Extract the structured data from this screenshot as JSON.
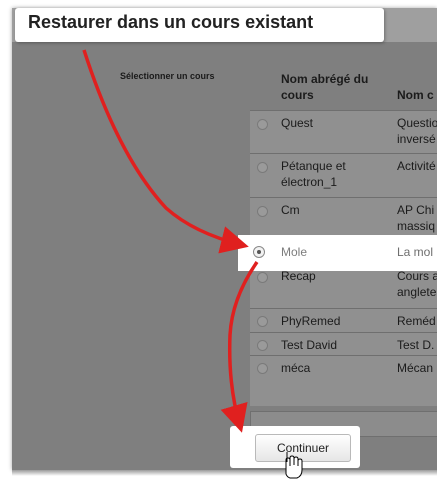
{
  "title": "Restaurer dans un cours existant",
  "select_label": "Sélectionner un cours",
  "table": {
    "col1_header": "Nom abrégé du cours",
    "col2_header": "Nom c",
    "rows": [
      {
        "short": "Quest",
        "full": "Questio\ninversé",
        "selected": false
      },
      {
        "short": "Pétanque et électron_1",
        "full": "Activité",
        "selected": false
      },
      {
        "short": "Cm",
        "full": "AP Chi\nmassiq",
        "selected": false
      },
      {
        "short": "Mole",
        "full": "La mol",
        "selected": true
      },
      {
        "short": "Recap",
        "full": "Cours a\nanglete",
        "selected": false
      },
      {
        "short": "PhyRemed",
        "full": "Reméd",
        "selected": false
      },
      {
        "short": "Test David",
        "full": "Test D.",
        "selected": false
      },
      {
        "short": "méca",
        "full": "Mécan",
        "selected": false
      }
    ]
  },
  "continue_label": "Continuer",
  "colors": {
    "arrow": "#e0201f",
    "highlight": "#ffffff",
    "overlay": "#7f7f7f"
  }
}
